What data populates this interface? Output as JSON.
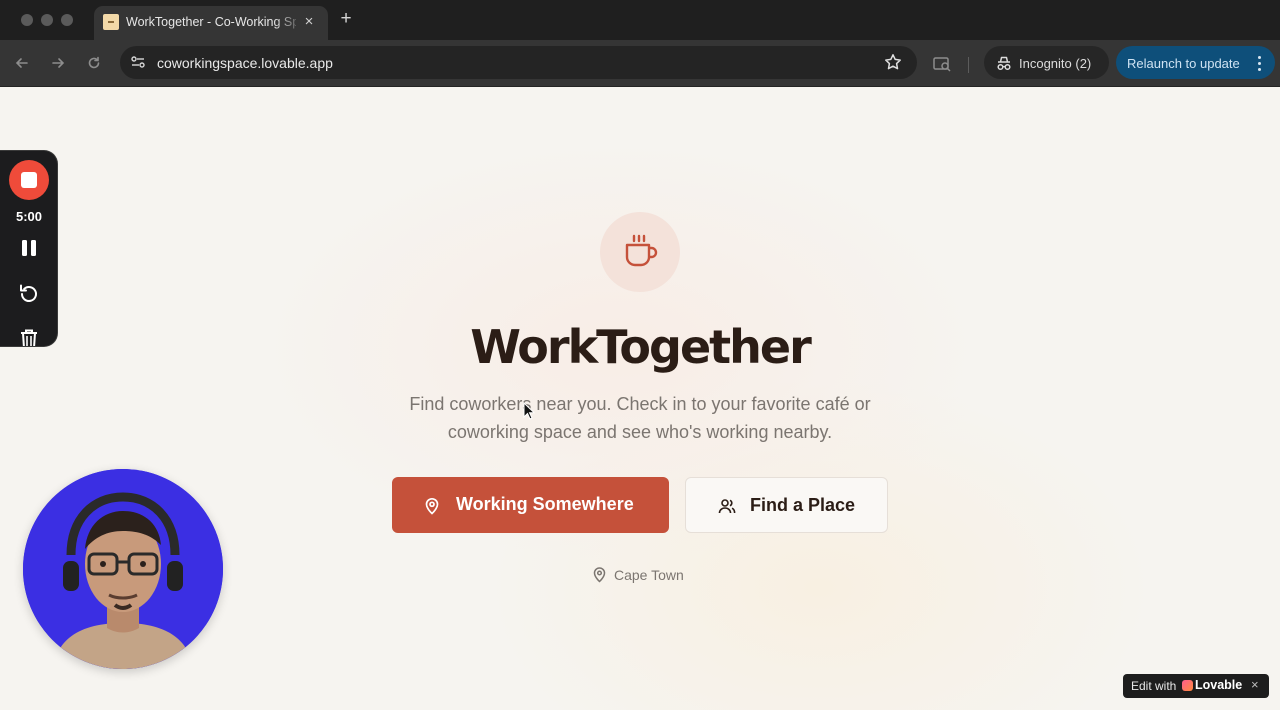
{
  "browser": {
    "tab": {
      "title": "WorkTogether - Co-Working Space",
      "close_label": "×"
    },
    "new_tab_label": "+",
    "url": "coworkingspace.lovable.app",
    "incognito_label": "Incognito (2)",
    "relaunch_label": "Relaunch to update"
  },
  "hero": {
    "title": "WorkTogether",
    "subtitle": "Find coworkers near you. Check in to your favorite café or coworking space and see who's working nearby.",
    "primary_button": "Working Somewhere",
    "secondary_button": "Find a Place",
    "location": "Cape Town"
  },
  "recorder": {
    "timer": "5:00"
  },
  "lovable_badge": {
    "edit_label": "Edit with",
    "brand": "Lovable",
    "close_label": "×"
  },
  "colors": {
    "accent": "#c5513a",
    "title": "#2b1d16",
    "page_bg": "#f6f4f0",
    "relaunch": "#0e4f7a",
    "record": "#ef4b3a"
  },
  "icons": [
    "site-info-icon",
    "star-icon",
    "lens-icon",
    "incognito-icon",
    "coffee-cup-icon",
    "map-pin-icon",
    "users-icon",
    "stop-icon",
    "pause-icon",
    "restart-icon",
    "trash-icon"
  ]
}
